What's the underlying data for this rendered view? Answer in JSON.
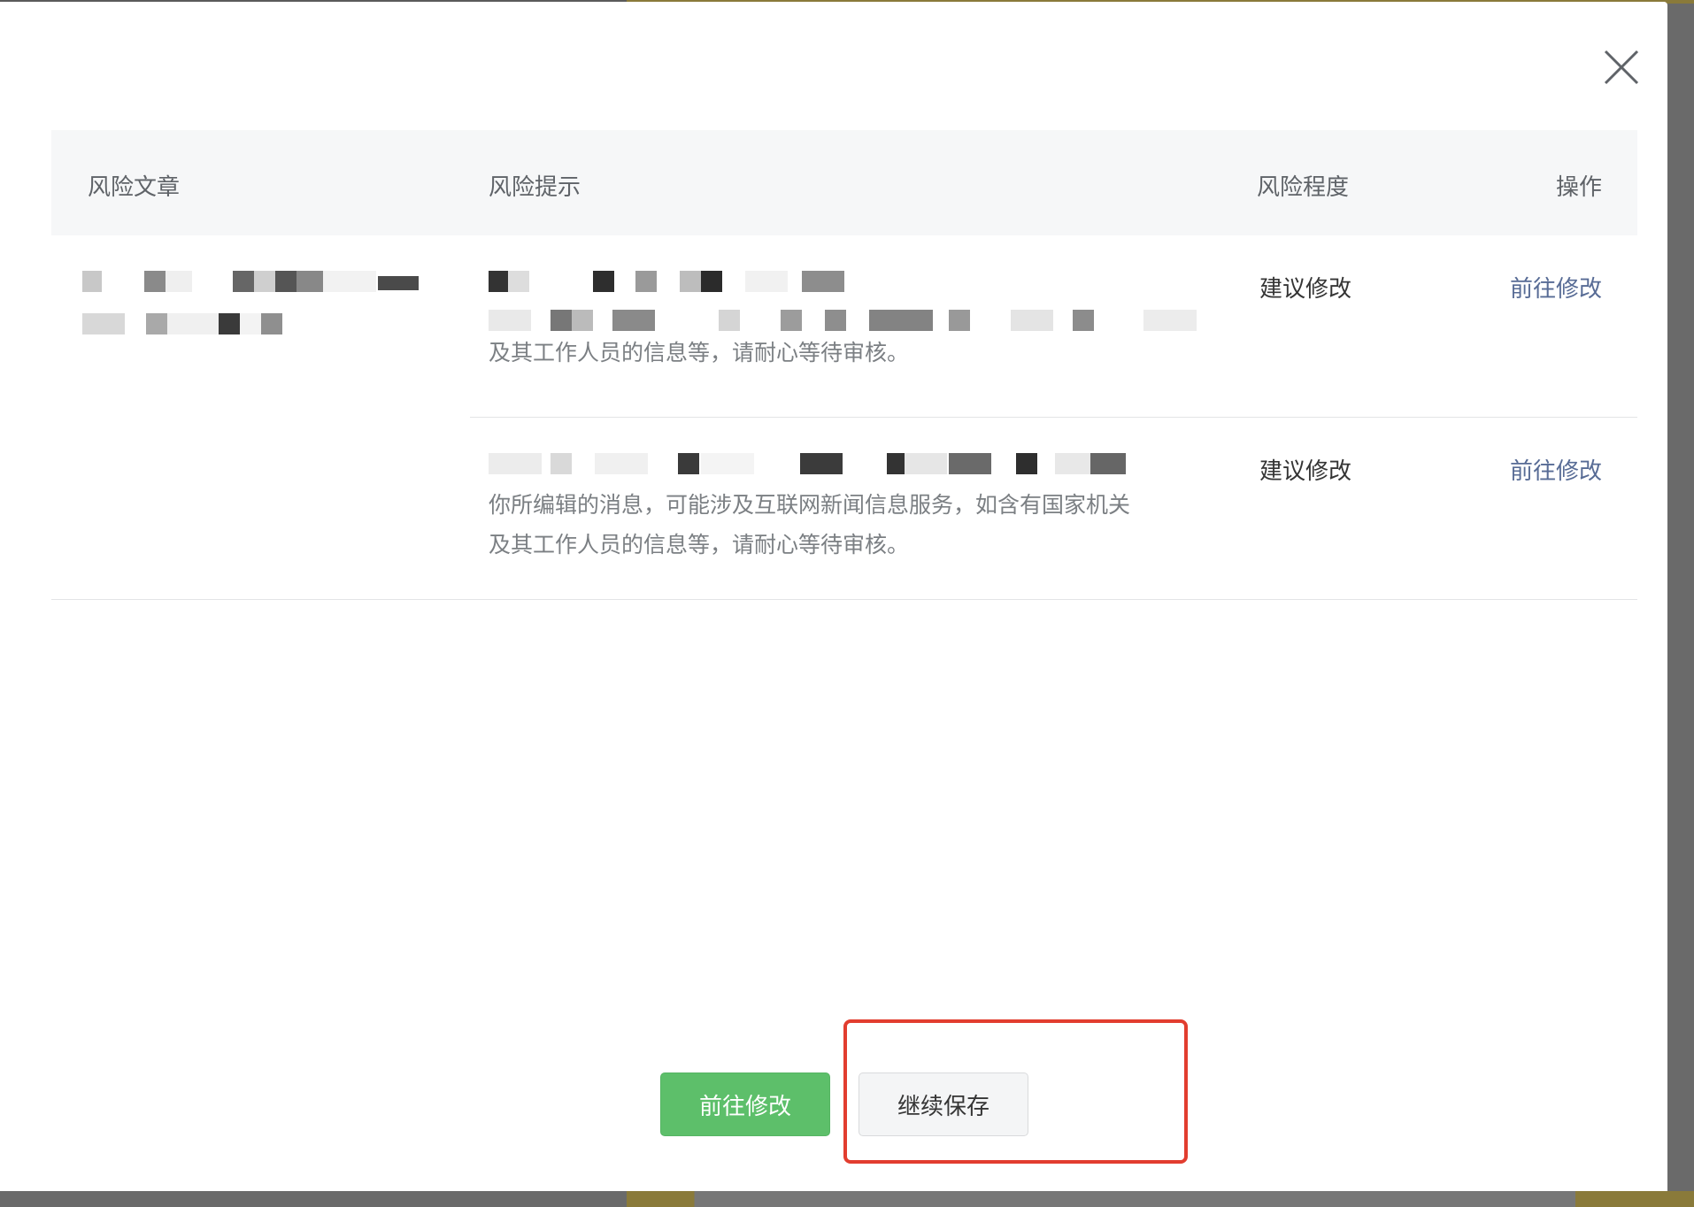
{
  "dialog": {
    "close_icon": "close-icon"
  },
  "table": {
    "headers": {
      "article": "风险文章",
      "tip": "风险提示",
      "level": "风险程度",
      "operation": "操作"
    },
    "rows": [
      {
        "tip_desc_visible": "及其工作人员的信息等，请耐心等待审核。",
        "level": "建议修改",
        "action": "前往修改"
      },
      {
        "tip_desc_line1": "你所编辑的消息，可能涉及互联网新闻信息服务，如含有国家机关",
        "tip_desc_line2": "及其工作人员的信息等，请耐心等待审核。",
        "level": "建议修改",
        "action": "前往修改"
      }
    ]
  },
  "footer": {
    "primary_label": "前往修改",
    "secondary_label": "继续保存"
  },
  "colors": {
    "primary_green": "#5dbf6a",
    "link_blue": "#576b95",
    "highlight_red": "#e23d2f"
  }
}
